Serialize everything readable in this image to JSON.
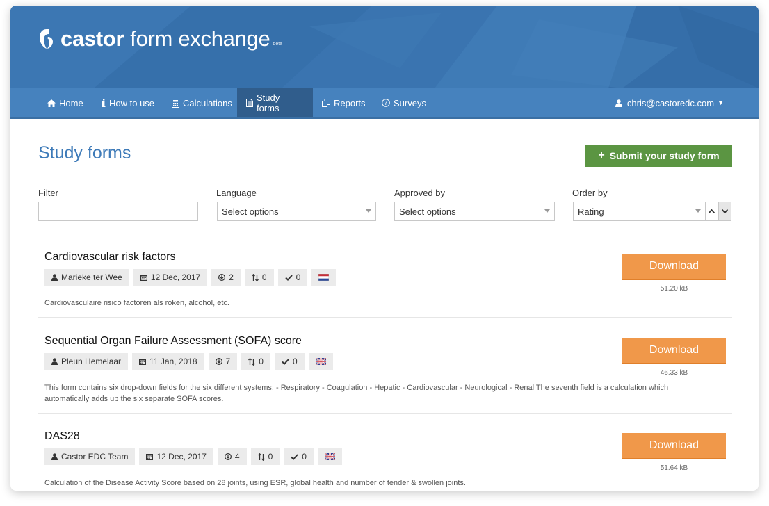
{
  "brand": {
    "name_bold": "castor",
    "name_rest": "form exchange",
    "tag": "beta"
  },
  "nav": {
    "items": [
      {
        "label": "Home",
        "icon": "home-icon"
      },
      {
        "label": "How to use",
        "icon": "info-icon"
      },
      {
        "label": "Calculations",
        "icon": "calculator-icon"
      },
      {
        "label": "Study forms",
        "icon": "document-icon",
        "active": true
      },
      {
        "label": "Reports",
        "icon": "reports-icon"
      },
      {
        "label": "Surveys",
        "icon": "question-icon"
      }
    ],
    "user": "chris@castoredc.com"
  },
  "page": {
    "title": "Study forms",
    "submit_label": "Submit your study form"
  },
  "filters": {
    "filter": {
      "label": "Filter",
      "value": ""
    },
    "language": {
      "label": "Language",
      "value": "Select options"
    },
    "approved_by": {
      "label": "Approved by",
      "value": "Select options"
    },
    "order_by": {
      "label": "Order by",
      "value": "Rating"
    }
  },
  "forms": [
    {
      "title": "Cardiovascular risk factors",
      "author": "Marieke ter Wee",
      "date": "12 Dec, 2017",
      "downloads": "2",
      "sort_count": "0",
      "approvals": "0",
      "flag": "netherlands-flag-icon",
      "description": "Cardiovasculaire risico factoren als roken, alcohol, etc.",
      "download_label": "Download",
      "size": "51.20 kB"
    },
    {
      "title": "Sequential Organ Failure Assessment (SOFA) score",
      "author": "Pleun Hemelaar",
      "date": "11 Jan, 2018",
      "downloads": "7",
      "sort_count": "0",
      "approvals": "0",
      "flag": "uk-flag-icon",
      "description": "This form contains six drop-down fields for the six different systems: - Respiratory - Coagulation - Hepatic - Cardiovascular - Neurological - Renal The seventh field is a calculation which automatically adds up the six separate SOFA scores.",
      "download_label": "Download",
      "size": "46.33 kB"
    },
    {
      "title": "DAS28",
      "author": "Castor EDC Team",
      "date": "12 Dec, 2017",
      "downloads": "4",
      "sort_count": "0",
      "approvals": "0",
      "flag": "uk-flag-icon",
      "description": "Calculation of the Disease Activity Score based on 28 joints, using ESR, global health and number of tender & swollen joints.",
      "download_label": "Download",
      "size": "51.64 kB"
    }
  ],
  "colors": {
    "hero": "#3a73ae",
    "nav": "#4682be",
    "nav_active": "#305d8c",
    "title": "#3d7ab8",
    "submit": "#5b9542",
    "download": "#f0984a"
  }
}
